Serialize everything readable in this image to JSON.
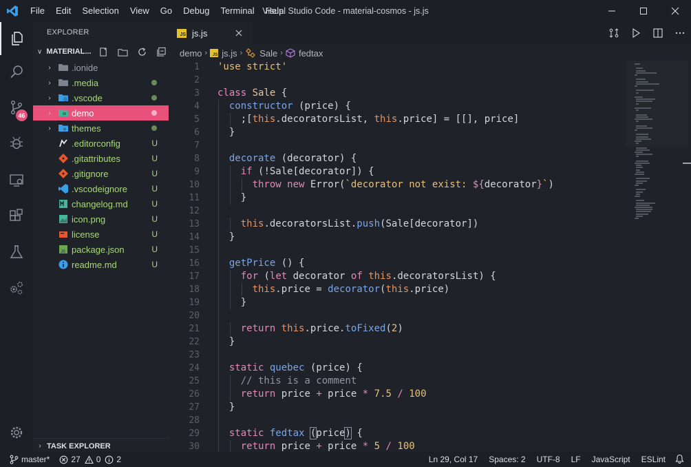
{
  "window": {
    "title": "Visual Studio Code - material-cosmos - js.js",
    "menu": [
      "File",
      "Edit",
      "Selection",
      "View",
      "Go",
      "Debug",
      "Terminal",
      "Help"
    ]
  },
  "activity": {
    "scm_badge": "46"
  },
  "sidebar": {
    "title": "EXPLORER",
    "section": "MATERIAL...",
    "items": [
      {
        "name": ".ionide",
        "type": "folder",
        "color": "#9aa0a8",
        "status": ""
      },
      {
        "name": ".media",
        "type": "folder",
        "color": "#a8d87a",
        "status": "dot"
      },
      {
        "name": ".vscode",
        "type": "folder",
        "color": "#a8d87a",
        "status": "dot"
      },
      {
        "name": "demo",
        "type": "folder",
        "color": "#ffffff",
        "status": "dot"
      },
      {
        "name": "themes",
        "type": "folder",
        "color": "#a8d87a",
        "status": "dot"
      },
      {
        "name": ".editorconfig",
        "type": "file",
        "color": "#a8d87a",
        "status": "U"
      },
      {
        "name": ".gitattributes",
        "type": "file",
        "color": "#a8d87a",
        "status": "U"
      },
      {
        "name": ".gitignore",
        "type": "file",
        "color": "#a8d87a",
        "status": "U"
      },
      {
        "name": ".vscodeignore",
        "type": "file",
        "color": "#a8d87a",
        "status": "U"
      },
      {
        "name": "changelog.md",
        "type": "file",
        "color": "#a8d87a",
        "status": "U"
      },
      {
        "name": "icon.png",
        "type": "file",
        "color": "#a8d87a",
        "status": "U"
      },
      {
        "name": "license",
        "type": "file",
        "color": "#a8d87a",
        "status": "U"
      },
      {
        "name": "package.json",
        "type": "file",
        "color": "#a8d87a",
        "status": "U"
      },
      {
        "name": "readme.md",
        "type": "file",
        "color": "#a8d87a",
        "status": "U"
      }
    ],
    "task_explorer": "TASK EXPLORER"
  },
  "editor": {
    "tab_label": "js.js",
    "breadcrumbs": [
      "demo",
      "js.js",
      "Sale",
      "fedtax"
    ],
    "line_numbers": [
      "1",
      "2",
      "3",
      "4",
      "5",
      "6",
      "7",
      "8",
      "9",
      "10",
      "11",
      "12",
      "13",
      "14",
      "15",
      "16",
      "17",
      "18",
      "19",
      "20",
      "21",
      "22",
      "23",
      "24",
      "25",
      "26",
      "27",
      "28",
      "29",
      "30"
    ]
  },
  "statusbar": {
    "branch": "master*",
    "errors": "27",
    "warnings": "0",
    "info": "2",
    "cursor": "Ln 29, Col 17",
    "spaces": "Spaces: 2",
    "encoding": "UTF-8",
    "eol": "LF",
    "language": "JavaScript",
    "linter": "ESLint"
  },
  "colors": {
    "accent": "#e8527a",
    "keyword": "#e08ab8",
    "string": "#e5c07b",
    "function": "#7aa6e8",
    "git_untracked": "#a8d87a"
  }
}
